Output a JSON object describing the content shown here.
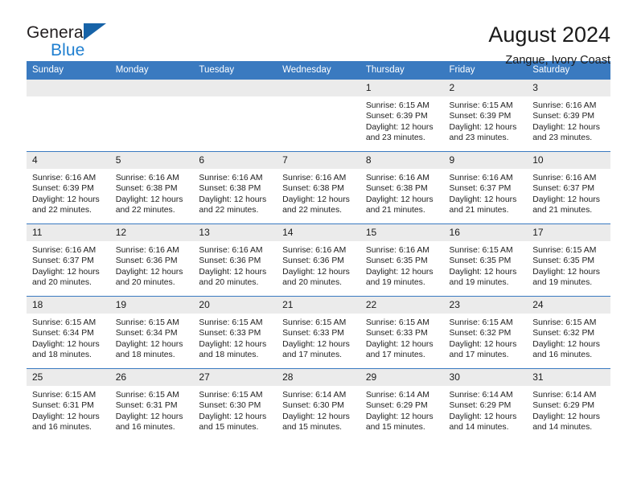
{
  "brand": {
    "name_part1": "General",
    "name_part2": "Blue",
    "logo_icon": "triangle-logo-icon"
  },
  "header": {
    "month_title": "August 2024",
    "location": "Zangue, Ivory Coast",
    "accent_color": "#3a7ac0",
    "daynum_bg": "#ebebeb"
  },
  "weekday_headers": [
    "Sunday",
    "Monday",
    "Tuesday",
    "Wednesday",
    "Thursday",
    "Friday",
    "Saturday"
  ],
  "weeks": [
    [
      {
        "day": "",
        "blank": true
      },
      {
        "day": "",
        "blank": true
      },
      {
        "day": "",
        "blank": true
      },
      {
        "day": "",
        "blank": true
      },
      {
        "day": "1",
        "sunrise": "Sunrise: 6:15 AM",
        "sunset": "Sunset: 6:39 PM",
        "daylight_line1": "Daylight: 12 hours",
        "daylight_line2": "and 23 minutes."
      },
      {
        "day": "2",
        "sunrise": "Sunrise: 6:15 AM",
        "sunset": "Sunset: 6:39 PM",
        "daylight_line1": "Daylight: 12 hours",
        "daylight_line2": "and 23 minutes."
      },
      {
        "day": "3",
        "sunrise": "Sunrise: 6:16 AM",
        "sunset": "Sunset: 6:39 PM",
        "daylight_line1": "Daylight: 12 hours",
        "daylight_line2": "and 23 minutes."
      }
    ],
    [
      {
        "day": "4",
        "sunrise": "Sunrise: 6:16 AM",
        "sunset": "Sunset: 6:39 PM",
        "daylight_line1": "Daylight: 12 hours",
        "daylight_line2": "and 22 minutes."
      },
      {
        "day": "5",
        "sunrise": "Sunrise: 6:16 AM",
        "sunset": "Sunset: 6:38 PM",
        "daylight_line1": "Daylight: 12 hours",
        "daylight_line2": "and 22 minutes."
      },
      {
        "day": "6",
        "sunrise": "Sunrise: 6:16 AM",
        "sunset": "Sunset: 6:38 PM",
        "daylight_line1": "Daylight: 12 hours",
        "daylight_line2": "and 22 minutes."
      },
      {
        "day": "7",
        "sunrise": "Sunrise: 6:16 AM",
        "sunset": "Sunset: 6:38 PM",
        "daylight_line1": "Daylight: 12 hours",
        "daylight_line2": "and 22 minutes."
      },
      {
        "day": "8",
        "sunrise": "Sunrise: 6:16 AM",
        "sunset": "Sunset: 6:38 PM",
        "daylight_line1": "Daylight: 12 hours",
        "daylight_line2": "and 21 minutes."
      },
      {
        "day": "9",
        "sunrise": "Sunrise: 6:16 AM",
        "sunset": "Sunset: 6:37 PM",
        "daylight_line1": "Daylight: 12 hours",
        "daylight_line2": "and 21 minutes."
      },
      {
        "day": "10",
        "sunrise": "Sunrise: 6:16 AM",
        "sunset": "Sunset: 6:37 PM",
        "daylight_line1": "Daylight: 12 hours",
        "daylight_line2": "and 21 minutes."
      }
    ],
    [
      {
        "day": "11",
        "sunrise": "Sunrise: 6:16 AM",
        "sunset": "Sunset: 6:37 PM",
        "daylight_line1": "Daylight: 12 hours",
        "daylight_line2": "and 20 minutes."
      },
      {
        "day": "12",
        "sunrise": "Sunrise: 6:16 AM",
        "sunset": "Sunset: 6:36 PM",
        "daylight_line1": "Daylight: 12 hours",
        "daylight_line2": "and 20 minutes."
      },
      {
        "day": "13",
        "sunrise": "Sunrise: 6:16 AM",
        "sunset": "Sunset: 6:36 PM",
        "daylight_line1": "Daylight: 12 hours",
        "daylight_line2": "and 20 minutes."
      },
      {
        "day": "14",
        "sunrise": "Sunrise: 6:16 AM",
        "sunset": "Sunset: 6:36 PM",
        "daylight_line1": "Daylight: 12 hours",
        "daylight_line2": "and 20 minutes."
      },
      {
        "day": "15",
        "sunrise": "Sunrise: 6:16 AM",
        "sunset": "Sunset: 6:35 PM",
        "daylight_line1": "Daylight: 12 hours",
        "daylight_line2": "and 19 minutes."
      },
      {
        "day": "16",
        "sunrise": "Sunrise: 6:15 AM",
        "sunset": "Sunset: 6:35 PM",
        "daylight_line1": "Daylight: 12 hours",
        "daylight_line2": "and 19 minutes."
      },
      {
        "day": "17",
        "sunrise": "Sunrise: 6:15 AM",
        "sunset": "Sunset: 6:35 PM",
        "daylight_line1": "Daylight: 12 hours",
        "daylight_line2": "and 19 minutes."
      }
    ],
    [
      {
        "day": "18",
        "sunrise": "Sunrise: 6:15 AM",
        "sunset": "Sunset: 6:34 PM",
        "daylight_line1": "Daylight: 12 hours",
        "daylight_line2": "and 18 minutes."
      },
      {
        "day": "19",
        "sunrise": "Sunrise: 6:15 AM",
        "sunset": "Sunset: 6:34 PM",
        "daylight_line1": "Daylight: 12 hours",
        "daylight_line2": "and 18 minutes."
      },
      {
        "day": "20",
        "sunrise": "Sunrise: 6:15 AM",
        "sunset": "Sunset: 6:33 PM",
        "daylight_line1": "Daylight: 12 hours",
        "daylight_line2": "and 18 minutes."
      },
      {
        "day": "21",
        "sunrise": "Sunrise: 6:15 AM",
        "sunset": "Sunset: 6:33 PM",
        "daylight_line1": "Daylight: 12 hours",
        "daylight_line2": "and 17 minutes."
      },
      {
        "day": "22",
        "sunrise": "Sunrise: 6:15 AM",
        "sunset": "Sunset: 6:33 PM",
        "daylight_line1": "Daylight: 12 hours",
        "daylight_line2": "and 17 minutes."
      },
      {
        "day": "23",
        "sunrise": "Sunrise: 6:15 AM",
        "sunset": "Sunset: 6:32 PM",
        "daylight_line1": "Daylight: 12 hours",
        "daylight_line2": "and 17 minutes."
      },
      {
        "day": "24",
        "sunrise": "Sunrise: 6:15 AM",
        "sunset": "Sunset: 6:32 PM",
        "daylight_line1": "Daylight: 12 hours",
        "daylight_line2": "and 16 minutes."
      }
    ],
    [
      {
        "day": "25",
        "sunrise": "Sunrise: 6:15 AM",
        "sunset": "Sunset: 6:31 PM",
        "daylight_line1": "Daylight: 12 hours",
        "daylight_line2": "and 16 minutes."
      },
      {
        "day": "26",
        "sunrise": "Sunrise: 6:15 AM",
        "sunset": "Sunset: 6:31 PM",
        "daylight_line1": "Daylight: 12 hours",
        "daylight_line2": "and 16 minutes."
      },
      {
        "day": "27",
        "sunrise": "Sunrise: 6:15 AM",
        "sunset": "Sunset: 6:30 PM",
        "daylight_line1": "Daylight: 12 hours",
        "daylight_line2": "and 15 minutes."
      },
      {
        "day": "28",
        "sunrise": "Sunrise: 6:14 AM",
        "sunset": "Sunset: 6:30 PM",
        "daylight_line1": "Daylight: 12 hours",
        "daylight_line2": "and 15 minutes."
      },
      {
        "day": "29",
        "sunrise": "Sunrise: 6:14 AM",
        "sunset": "Sunset: 6:29 PM",
        "daylight_line1": "Daylight: 12 hours",
        "daylight_line2": "and 15 minutes."
      },
      {
        "day": "30",
        "sunrise": "Sunrise: 6:14 AM",
        "sunset": "Sunset: 6:29 PM",
        "daylight_line1": "Daylight: 12 hours",
        "daylight_line2": "and 14 minutes."
      },
      {
        "day": "31",
        "sunrise": "Sunrise: 6:14 AM",
        "sunset": "Sunset: 6:29 PM",
        "daylight_line1": "Daylight: 12 hours",
        "daylight_line2": "and 14 minutes."
      }
    ]
  ]
}
